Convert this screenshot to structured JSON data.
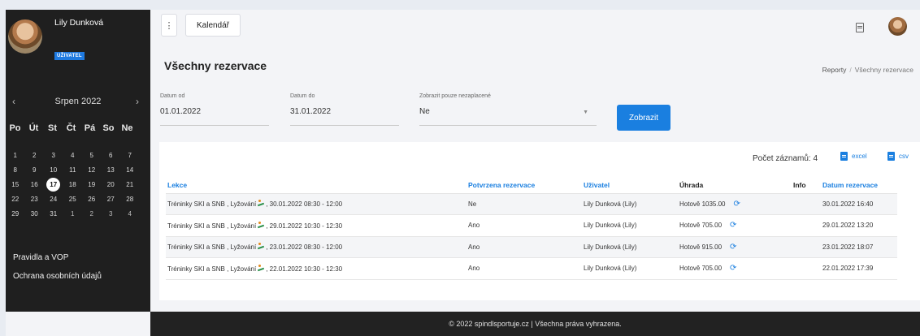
{
  "user": {
    "name": "Lily Dunková",
    "role": "UŽIVATEL"
  },
  "calendar": {
    "month_title": "Srpen 2022",
    "prev": "‹",
    "next": "›",
    "weekdays": [
      "Po",
      "Út",
      "St",
      "Čt",
      "Pá",
      "So",
      "Ne"
    ],
    "days": [
      "1",
      "2",
      "3",
      "4",
      "5",
      "6",
      "7",
      "8",
      "9",
      "10",
      "11",
      "12",
      "13",
      "14",
      "15",
      "16",
      "17",
      "18",
      "19",
      "20",
      "21",
      "22",
      "23",
      "24",
      "25",
      "26",
      "27",
      "28",
      "29",
      "30",
      "31",
      "1",
      "2",
      "3",
      "4"
    ],
    "today": "17"
  },
  "sidebar": {
    "links": [
      "Pravidla a VOP",
      "Ochrana osobních údajů"
    ]
  },
  "topbar": {
    "menu": "⋮",
    "tab": "Kalendář"
  },
  "page": {
    "title": "Všechny rezervace"
  },
  "breadcrumb": {
    "parent": "Reporty",
    "separator": "/",
    "current": "Všechny rezervace"
  },
  "filters": {
    "from_label": "Datum od",
    "from_value": "01.01.2022",
    "to_label": "Datum do",
    "to_value": "31.01.2022",
    "unpaid_label": "Zobrazit pouze nezaplacené",
    "unpaid_value": "Ne",
    "submit": "Zobrazit"
  },
  "table": {
    "count_label": "Počet záznamů: 4",
    "export_excel": "excel",
    "export_csv": "csv",
    "columns": [
      "Lekce",
      "Potvrzena rezervace",
      "Uživatel",
      "Úhrada",
      "Info",
      "Datum rezervace"
    ],
    "rows": [
      {
        "lesson_a": "Tréninky SKI a SNB , Lyžování",
        "lesson_b": ", 30.01.2022 08:30 - 12:00",
        "confirmed": "Ne",
        "user": "Lily Dunková (Lily)",
        "payment": "Hotově 1035.00",
        "info": "",
        "date": "30.01.2022 16:40"
      },
      {
        "lesson_a": "Tréninky SKI a SNB , Lyžování",
        "lesson_b": ", 29.01.2022 10:30 - 12:30",
        "confirmed": "Ano",
        "user": "Lily Dunková (Lily)",
        "payment": "Hotově 705.00",
        "info": "",
        "date": "29.01.2022 13:20"
      },
      {
        "lesson_a": "Tréninky SKI a SNB , Lyžování",
        "lesson_b": ", 23.01.2022 08:30 - 12:00",
        "confirmed": "Ano",
        "user": "Lily Dunková (Lily)",
        "payment": "Hotově 915.00",
        "info": "",
        "date": "23.01.2022 18:07"
      },
      {
        "lesson_a": "Tréninky SKI a SNB , Lyžování",
        "lesson_b": ", 22.01.2022 10:30 - 12:30",
        "confirmed": "Ano",
        "user": "Lily Dunková (Lily)",
        "payment": "Hotově 705.00",
        "info": "",
        "date": "22.01.2022 17:39"
      }
    ]
  },
  "footer": {
    "text": "© 2022 spindlsportuje.cz | Všechna práva vyhrazena."
  },
  "colors": {
    "accent": "#1a7fe0",
    "sidebar": "#1f1f1f",
    "footer": "#222222"
  }
}
